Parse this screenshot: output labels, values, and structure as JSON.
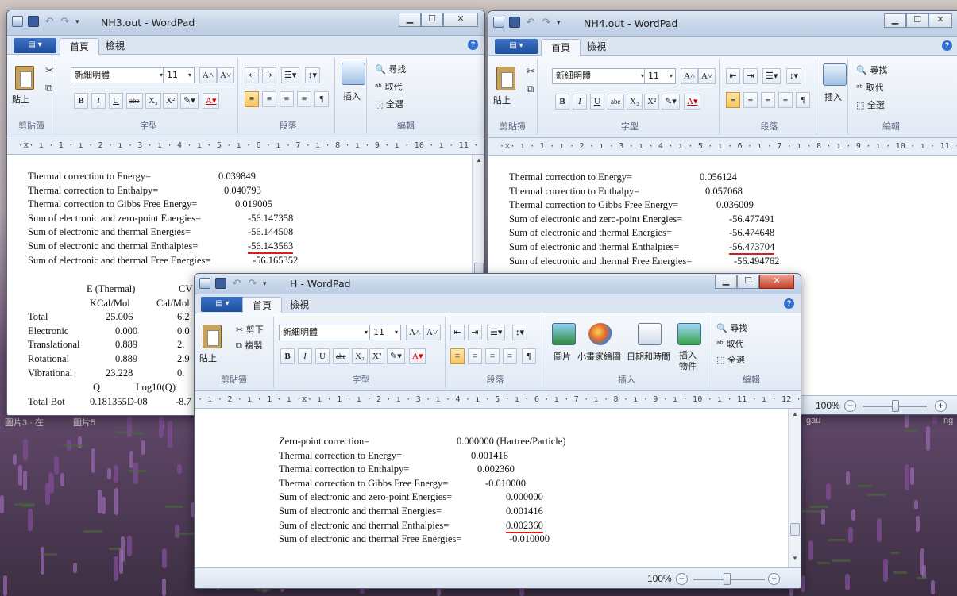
{
  "desktop": {
    "taskbar_ghost_left": "圖片3 · 在",
    "taskbar_ghost_left2": "圖片5",
    "ghost_right": "gau",
    "ghost_right2": "ng"
  },
  "common": {
    "app_menu": "▤ ▾",
    "tab_home": "首頁",
    "tab_view": "檢視",
    "help": "?",
    "paste": "貼上",
    "cut": "剪下",
    "copy": "複製",
    "font_name": "新細明體",
    "font_size": "11",
    "find": "尋找",
    "replace": "取代",
    "select_all": "全選",
    "grp_clipboard": "剪貼簿",
    "grp_font": "字型",
    "grp_paragraph": "段落",
    "grp_insert": "插入",
    "grp_edit": "編輯",
    "insert_btn": "插入",
    "picture": "圖片",
    "paint": "小畫家繪圖",
    "datetime": "日期和時間",
    "insert_object": "插入\n物件",
    "bold": "B",
    "italic": "I",
    "underline": "U",
    "strike": "abe",
    "sub": "X₂",
    "sup": "X²",
    "grow": "A˄",
    "shrink": "A˅",
    "minimize": "▁",
    "maximize": "☐",
    "close": "✕",
    "zoom": "100%",
    "zoom_minus": "−",
    "zoom_plus": "+"
  },
  "win_nh3": {
    "title": "NH3.out - WordPad",
    "ruler": "·⧖· ı · 1 · ı · 2 · ı · 3 · ı · 4 · ı · 5 · ı · 6 · ı · 7 · ı · 8 · ı · 9 · ı · 10 · ı · 11 · ı · 12 · ı · 13 · ı · 14 · ı · 15⌊ ı · 16",
    "lines": [
      {
        "label": "Thermal correction to Energy=",
        "value": "0.039849"
      },
      {
        "label": "Thermal correction to Enthalpy=",
        "value": "0.040793"
      },
      {
        "label": "Thermal correction to Gibbs Free Energy=",
        "value": "0.019005"
      },
      {
        "label": "Sum of electronic and zero-point Energies=",
        "value": "-56.147358"
      },
      {
        "label": "Sum of electronic and thermal Energies=",
        "value": "-56.144508"
      },
      {
        "label": "Sum of electronic and thermal Enthalpies=",
        "value": "-56.143563"
      },
      {
        "label": "Sum of electronic and thermal Free Energies=",
        "value": "-56.165352"
      }
    ],
    "table_header1": "E (Thermal)",
    "table_header2": "CV",
    "table_unit1": "KCal/Mol",
    "table_unit2": "Cal/Mol",
    "rows": [
      {
        "name": "Total",
        "value": "25.006",
        "cv": "6.2"
      },
      {
        "name": "Electronic",
        "value": "0.000",
        "cv": "0.0"
      },
      {
        "name": "Translational",
        "value": "0.889",
        "cv": "2."
      },
      {
        "name": "Rotational",
        "value": "0.889",
        "cv": "2.9"
      },
      {
        "name": "Vibrational",
        "value": "23.228",
        "cv": "0."
      }
    ],
    "q_header": "Q",
    "log_header": "Log10(Q)",
    "last_row_name": "Total Bot",
    "last_row_value": "0.181355D-08",
    "last_row_log": "-8.7"
  },
  "win_nh4": {
    "title": "NH4.out - WordPad",
    "ruler": "·⧖· ı · 1 · ı · 2 · ı · 3 · ı · 4 · ı · 5 · ı · 6 · ı · 7 · ı · 8 · ı · 9 · ı · 10 · ı · 11 · ı · 12 · ı · 13 · ı · 14 · ı · 15⌊ ı · 16",
    "lines": [
      {
        "label": "Thermal correction to Energy=",
        "value": "0.056124"
      },
      {
        "label": "Thermal correction to Enthalpy=",
        "value": "0.057068"
      },
      {
        "label": "Thermal correction to Gibbs Free Energy=",
        "value": "0.036009"
      },
      {
        "label": "Sum of electronic and zero-point Energies=",
        "value": "-56.477491"
      },
      {
        "label": "Sum of electronic and thermal Energies=",
        "value": "-56.474648"
      },
      {
        "label": "Sum of electronic and thermal Enthalpies=",
        "value": "-56.473704"
      },
      {
        "label": "Sum of electronic and thermal Free Energies=",
        "value": "-56.494762"
      }
    ],
    "zoom": "100%"
  },
  "win_h": {
    "title": "H - WordPad",
    "ruler": "· ı · 2 · ı · 1 · ı ·⧖· ı · 1 · ı · 2 · ı · 3 · ı · 4 · ı · 5 · ı · 6 · ı · 7 · ı · 8 · ı · 9 · ı · 10 · ı · 11 · ı · 12 · ı · 13 · ı · 14 · ı · 15⌊ ı · 16 · ı · 17 · ı · 18",
    "lines": [
      {
        "label": "Zero-point correction=",
        "value": "0.000000 (Hartree/Particle)"
      },
      {
        "label": "Thermal correction to Energy=",
        "value": "0.001416"
      },
      {
        "label": "Thermal correction to Enthalpy=",
        "value": "0.002360"
      },
      {
        "label": "Thermal correction to Gibbs Free Energy=",
        "value": "-0.010000"
      },
      {
        "label": "Sum of electronic and zero-point Energies=",
        "value": "0.000000"
      },
      {
        "label": "Sum of electronic and thermal Energies=",
        "value": "0.001416"
      },
      {
        "label": "Sum of electronic and thermal Enthalpies=",
        "value": "0.002360"
      },
      {
        "label": "Sum of electronic and thermal Free Energies=",
        "value": "-0.010000"
      }
    ],
    "zoom": "100%"
  },
  "colors": {
    "highlight_underline": "#d81b1b",
    "title_bar": "#c9d7ea",
    "close_button": "#c7412a"
  }
}
